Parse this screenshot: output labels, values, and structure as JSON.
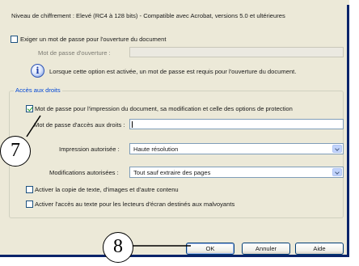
{
  "dialog": {
    "encryption_level": "Niveau de chiffrement : Elevé (RC4 à 128 bits) - Compatible avec Acrobat, versions 5.0 et ultérieures",
    "open_password": {
      "checkbox_label": "Exiger un mot de passe pour l'ouverture du document",
      "checked": false,
      "field_label": "Mot de passe d'ouverture :",
      "value": "",
      "info_text": "Lorsque cette option est activée, un mot de passe est requis pour l'ouverture du document."
    },
    "permissions": {
      "group_label": "Accès aux droits",
      "checkbox_label": "Mot de passe pour l'impression du document, sa modification et celle des options de protection",
      "checked": true,
      "field_label": "Mot de passe d'accès aux droits :",
      "value": "",
      "printing_label": "Impression autorisée :",
      "printing_value": "Haute résolution",
      "changes_label": "Modifications autorisées :",
      "changes_value": "Tout sauf extraire des pages",
      "copy_label": "Activer la copie de texte, d'images et d'autre contenu",
      "copy_checked": false,
      "accessibility_label": "Activer l'accès au texte pour les lecteurs d'écran destinés aux malvoyants",
      "accessibility_checked": false
    },
    "buttons": {
      "ok": "OK",
      "cancel": "Annuler",
      "help": "Aide"
    }
  },
  "callouts": {
    "seven": "7",
    "eight": "8"
  },
  "icons": {
    "info": "info-icon",
    "dropdown": "chevron-down-icon"
  },
  "colors": {
    "dialog_bg": "#ece9d8",
    "group_label": "#0046d5",
    "frame": "#0a246a"
  }
}
